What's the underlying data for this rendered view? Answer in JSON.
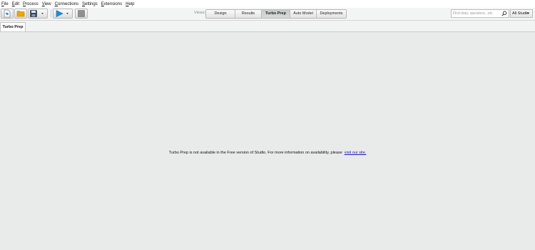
{
  "menu": [
    {
      "key": "F",
      "rest": "ile"
    },
    {
      "key": "E",
      "rest": "dit"
    },
    {
      "key": "P",
      "rest": "rocess"
    },
    {
      "key": "V",
      "rest": "iew"
    },
    {
      "key": "C",
      "rest": "onnections"
    },
    {
      "key": "S",
      "rest": "ettings"
    },
    {
      "key": "E",
      "rest": "xtensions"
    },
    {
      "key": "H",
      "rest": "elp"
    }
  ],
  "views": {
    "label": "Views:",
    "buttons": [
      "Design",
      "Results",
      "Turbo Prep",
      "Auto Model",
      "Deployments"
    ],
    "active": "Turbo Prep"
  },
  "search": {
    "placeholder": "Find data, operators...etc"
  },
  "studio": {
    "label": "All Studio"
  },
  "tab": {
    "label": "Turbo Prep"
  },
  "message": {
    "text": "Turbo Prep is not available in the Free version of Studio. For more information on availability, please",
    "link": "visit our site."
  },
  "colors": {
    "background": "#e9eaea",
    "run_blue": "#1f8fd9",
    "folder_orange": "#f0a500",
    "link": "#1a17b8"
  },
  "icons": [
    "new-process-icon",
    "open-folder-icon",
    "save-icon",
    "dropdown-arrow-icon",
    "run-icon",
    "stop-icon",
    "search-icon",
    "chevron-down-icon"
  ]
}
